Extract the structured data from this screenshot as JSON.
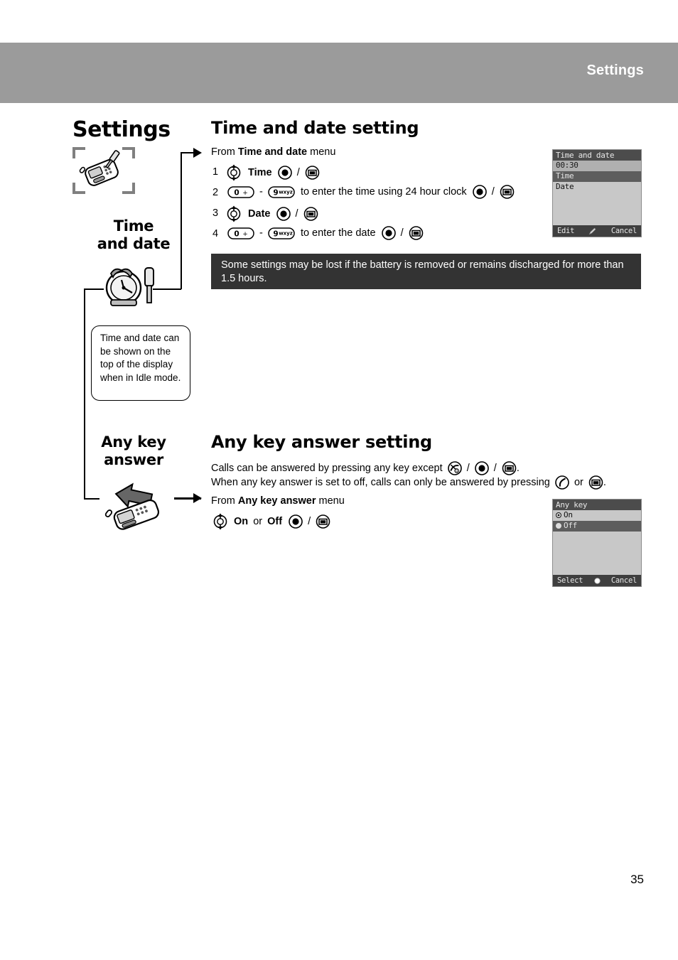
{
  "header": {
    "title": "Settings"
  },
  "chapter": {
    "title": "Settings",
    "icon": "phone-settings-icon"
  },
  "rail": {
    "items": [
      {
        "label": "Time\nand date",
        "label_line1": "Time",
        "label_line2": "and date",
        "icon": "clock-screwdriver-icon"
      },
      {
        "label": "Any key\nanswer",
        "label_line1": "Any key",
        "label_line2": "answer",
        "icon": "phone-arrow-icon"
      }
    ]
  },
  "note": {
    "text": "Time and date can be shown on the top of the display when in Idle mode."
  },
  "sections": [
    {
      "title": "Time and date setting",
      "intro_prefix": "From ",
      "intro_bold": "Time and date",
      "intro_suffix": " menu",
      "steps": [
        {
          "num": "1",
          "label": "Time"
        },
        {
          "num": "2",
          "text": "to enter the time using 24 hour clock"
        },
        {
          "num": "3",
          "label": "Date"
        },
        {
          "num": "4",
          "text": "to enter the date"
        }
      ]
    },
    {
      "title": "Any key answer setting",
      "desc_line1_a": "Calls can be answered by pressing any key except",
      "desc_line1_b": ".",
      "desc_line2_a": "When any key answer is set to off, calls can only be answered by pressing",
      "desc_line2_or": "or",
      "desc_line2_b": ".",
      "intro_prefix": "From ",
      "intro_bold": "Any key answer",
      "intro_suffix": " menu",
      "option_on": "On",
      "option_or": "or",
      "option_off": "Off"
    }
  ],
  "tip": {
    "text": "Some settings may be lost if the battery is removed or remains discharged for more than 1.5 hours."
  },
  "keys": {
    "nav": "navigation-key-icon",
    "ok": "center-select-key-icon",
    "soft": "soft-key-icon",
    "num_zero": "0 +",
    "num_nine": "9",
    "num_nine_sub": "wxyz",
    "end_call": "end-call-key-icon",
    "send_call": "send-call-key-icon",
    "separator": "/",
    "dash": "-"
  },
  "phone_screens": [
    {
      "title": "Time and date",
      "rows": [
        {
          "text": "00:30",
          "style": "hl-light"
        },
        {
          "text": "Time",
          "style": "hl-dark"
        },
        {
          "text": "Date",
          "style": "plain"
        }
      ],
      "soft_left": "Edit",
      "soft_center_icon": "pencil-icon",
      "soft_right": "Cancel"
    },
    {
      "title": "Any key",
      "rows": [
        {
          "text": "On",
          "style": "plain",
          "radio": "selected"
        },
        {
          "text": "Off",
          "style": "hl-dark",
          "radio": "unselected"
        }
      ],
      "soft_left": "Select",
      "soft_center_icon": "circle-icon",
      "soft_right": "Cancel"
    }
  ],
  "page_number": "35",
  "colors": {
    "header_bar": "#9b9b9b",
    "tip_box": "#333333",
    "screen_bg": "#c8c8c8",
    "screen_title": "#4c4c4c"
  }
}
